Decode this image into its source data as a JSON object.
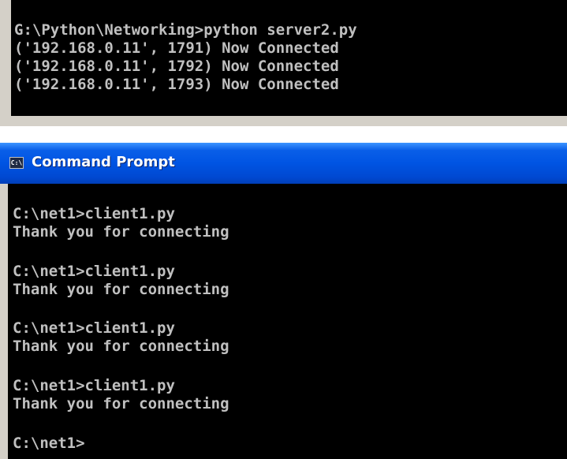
{
  "server_window": {
    "lines": [
      "G:\\Python\\Networking>python server2.py",
      "('192.168.0.11', 1791) Now Connected",
      "('192.168.0.11', 1792) Now Connected",
      "('192.168.0.11', 1793) Now Connected"
    ]
  },
  "client_window": {
    "title": "Command Prompt",
    "icon": {
      "name": "console-icon",
      "glyph": "C:\\"
    },
    "lines": [
      "C:\\net1>client1.py",
      "Thank you for connecting",
      "C:\\net1>client1.py",
      "Thank you for connecting",
      "C:\\net1>client1.py",
      "Thank you for connecting",
      "C:\\net1>client1.py",
      "Thank you for connecting",
      "C:\\net1>"
    ]
  },
  "colors": {
    "console_background": "#000000",
    "console_text": "#c0c0c0",
    "titlebar_blue": "#0054e3",
    "window_frame": "#d4d0c8"
  }
}
